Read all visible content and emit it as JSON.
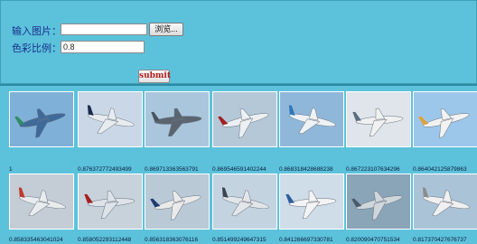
{
  "form": {
    "input_image_label": "输入图片：",
    "file_path_value": "",
    "browse_label": "浏览...",
    "color_ratio_label": "色彩比例：",
    "color_ratio_value": "0.8",
    "submit_label": "submit"
  },
  "results": [
    {
      "score": "1",
      "sky": "#7fb0d8",
      "plane": "#3e6a9a",
      "tail": "#2f8a66"
    },
    {
      "score": "0.876372772493499",
      "sky": "#c9d7e6",
      "plane": "#e8ecef",
      "tail": "#1b2a4e"
    },
    {
      "score": "0.869713363563791",
      "sky": "#a9c6dd",
      "plane": "#5a6570",
      "tail": "#4b5560"
    },
    {
      "score": "0.869546591402244",
      "sky": "#b5c8d8",
      "plane": "#ecf0f2",
      "tail": "#a3201f"
    },
    {
      "score": "0.868318428688238",
      "sky": "#8fb7da",
      "plane": "#eef2f5",
      "tail": "#2b78b8"
    },
    {
      "score": "0.867223107634296",
      "sky": "#dfe5ea",
      "plane": "#f1f1f1",
      "tail": "#5a6c80"
    },
    {
      "score": "0.864042125879863",
      "sky": "#9dc7ea",
      "plane": "#f2f2f2",
      "tail": "#e0a13b"
    },
    {
      "score": "0.858335463041024",
      "sky": "#c4cdd6",
      "plane": "#e9ecee",
      "tail": "#c0392b"
    },
    {
      "score": "0.858052293112448",
      "sky": "#c7d2da",
      "plane": "#dde3e8",
      "tail": "#a3201f"
    },
    {
      "score": "0.856318363076116",
      "sky": "#b9c9d6",
      "plane": "#eaeaea",
      "tail": "#1f3c72"
    },
    {
      "score": "0.851499249647315",
      "sky": "#c3d3e0",
      "plane": "#e3e6e9",
      "tail": "#3b4350"
    },
    {
      "score": "0.841266697330781",
      "sky": "#cfdde8",
      "plane": "#f4f4f4",
      "tail": "#2c5d9a"
    },
    {
      "score": "0.820090470751534",
      "sky": "#8aa4b8",
      "plane": "#cfd6dc",
      "tail": "#4a5a6a"
    },
    {
      "score": "0.817370427676737",
      "sky": "#aac3d6",
      "plane": "#f0f0f0",
      "tail": "#8c8c8c"
    }
  ]
}
